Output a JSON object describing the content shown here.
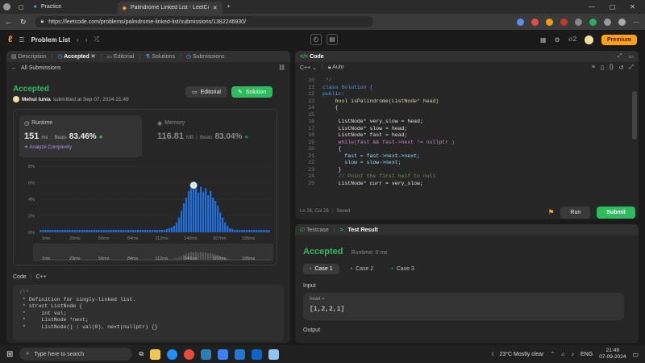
{
  "browser": {
    "tabs": [
      {
        "label": "Practice",
        "active": false
      },
      {
        "label": "Palindrome Linked List - LeetCo",
        "active": true
      }
    ],
    "url": "https://leetcode.com/problems/palindrome-linked-list/submissions/1382246930/"
  },
  "header": {
    "problem_list": "Problem List",
    "streak": "2",
    "premium": "Premium"
  },
  "left_panel": {
    "tabs": [
      "Description",
      "Accepted",
      "Editorial",
      "Solutions",
      "Submissions"
    ],
    "all_submissions": "All Submissions",
    "status": "Accepted",
    "author": "Mehul lunia",
    "submitted": "submitted at Sep 07, 2024 21:49",
    "editorial_btn": "Editorial",
    "solution_btn": "Solution",
    "runtime": {
      "label": "Runtime",
      "value": "151",
      "unit": "ms",
      "beats_label": "Beats",
      "beats": "83.46%",
      "analyze": "Analyze Complexity"
    },
    "memory": {
      "label": "Memory",
      "value": "116.81",
      "unit": "MB",
      "beats_label": "Beats",
      "beats": "83.04%"
    },
    "code_label": "Code",
    "code_lang": "C++",
    "code_lines": [
      "/**",
      " * Definition for singly-linked list.",
      " * struct ListNode {",
      " *     int val;",
      " *     ListNode *next;",
      " *     ListNode() : val(0), next(nullptr) {}"
    ]
  },
  "chart_data": {
    "type": "bar",
    "x_ticks": [
      "1ms",
      "29ms",
      "56ms",
      "84ms",
      "112ms",
      "140ms",
      "167ms",
      "195ms"
    ],
    "y_ticks": [
      "8%",
      "6%",
      "4%",
      "2%",
      "0%"
    ],
    "ylim": [
      0,
      8
    ],
    "values": [
      0.3,
      0.3,
      0.3,
      0.3,
      0.3,
      0.3,
      0.3,
      0.3,
      0.3,
      0.3,
      0.3,
      0.3,
      0.3,
      0.3,
      0.3,
      0.3,
      0.3,
      0.3,
      0.3,
      0.3,
      0.3,
      0.3,
      0.3,
      0.3,
      0.3,
      0.3,
      0.3,
      0.3,
      0.3,
      0.3,
      0.3,
      0.3,
      0.3,
      0.3,
      0.3,
      0.3,
      0.3,
      0.3,
      0.3,
      0.3,
      0.3,
      0.3,
      0.3,
      0.3,
      0.3,
      0.3,
      0.3,
      0.3,
      0.3,
      0.3,
      0.3,
      0.3,
      0.4,
      0.5,
      0.6,
      0.8,
      1.2,
      1.8,
      2.6,
      3.5,
      4.2,
      5.0,
      5.6,
      5.2,
      5.8,
      4.8,
      5.5,
      4.9,
      5.3,
      4.5,
      5.0,
      4.2,
      3.8,
      3.2,
      2.4,
      1.8,
      1.2,
      0.8,
      0.5,
      0.4,
      0.3,
      0.3,
      0.3,
      0.3,
      0.3,
      0.3,
      0.3,
      0.3,
      0.3,
      0.3,
      0.3,
      0.3,
      0.3,
      0.3,
      0.3
    ],
    "highlight_index": 63,
    "bar_color": "#1f6fdb",
    "grid": true
  },
  "code_panel": {
    "title": "Code",
    "lang": "C++",
    "mode": "Auto",
    "status": "Ln 26, Col 28",
    "saved": "Saved",
    "lines": [
      {
        "n": "10",
        "t": " */"
      },
      {
        "n": "11",
        "t": "class Solution {"
      },
      {
        "n": "12",
        "t": "public:"
      },
      {
        "n": "13",
        "t": "    bool isPalindrome(ListNode* head)"
      },
      {
        "n": "14",
        "t": "    {"
      },
      {
        "n": "15",
        "t": ""
      },
      {
        "n": "16",
        "t": "     ListNode* very_slow = head;"
      },
      {
        "n": "17",
        "t": "     ListNode* slow = head;"
      },
      {
        "n": "18",
        "t": "     ListNode* fast = head;"
      },
      {
        "n": "19",
        "t": "     while(fast && fast->next != nullptr )"
      },
      {
        "n": "20",
        "t": "     {"
      },
      {
        "n": "21",
        "t": "       fast = fast->next->next;"
      },
      {
        "n": "22",
        "t": "       slow = slow->next;"
      },
      {
        "n": "23",
        "t": "     }"
      },
      {
        "n": "24",
        "t": "     // Point the first half to null"
      },
      {
        "n": "25",
        "t": "     ListNode* curr = very_slow;"
      }
    ],
    "run": "Run",
    "submit": "Submit"
  },
  "test_panel": {
    "tabs": [
      "Testcase",
      "Test Result"
    ],
    "status": "Accepted",
    "runtime": "Runtime: 0 ms",
    "cases": [
      "Case 1",
      "Case 2",
      "Case 3"
    ],
    "input_label": "Input",
    "param": "head =",
    "param_value": "[1,2,2,1]",
    "output_label": "Output"
  },
  "taskbar": {
    "search": "Type here to search",
    "weather": "23°C  Mostly clear",
    "lang": "ENG",
    "time": "21:49",
    "date": "07-09-2024"
  },
  "colors": {
    "accent": "#ffa116",
    "green": "#2cbb5d",
    "blue": "#1f6fdb"
  }
}
